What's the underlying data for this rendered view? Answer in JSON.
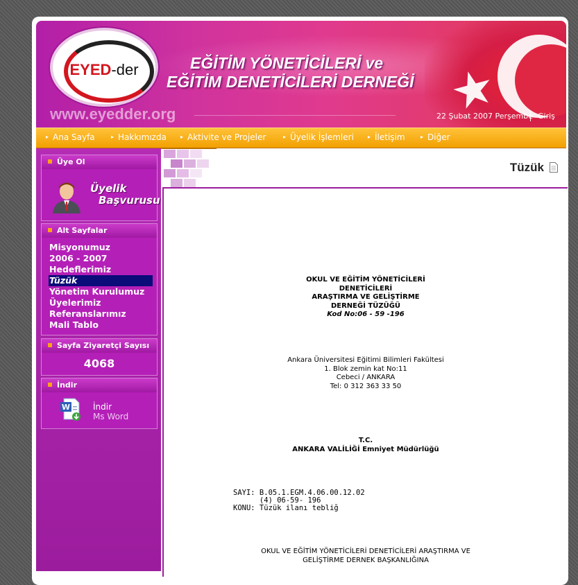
{
  "header": {
    "logo_text_brand": "EYED",
    "logo_text_suffix": "-der",
    "title_line1": "EĞİTİM YÖNETİCİLERİ ve",
    "title_line2": "EĞİTİM DENETİCİLERİ DERNEĞİ",
    "url": "www.eyedder.org",
    "date": "22 Şubat 2007 Perşembe",
    "login": "Giriş"
  },
  "nav": {
    "items": [
      "Ana Sayfa",
      "Hakkımızda",
      "Aktivite ve Projeler",
      "Üyelik İşlemleri",
      "İletişim",
      "Diğer"
    ]
  },
  "sidebar": {
    "uye_ol": {
      "title": "Üye Ol",
      "link_line1": "Üyelik",
      "link_line2": "Başvurusu"
    },
    "alt_sayfalar": {
      "title": "Alt Sayfalar",
      "items": [
        "Misyonumuz",
        "2006 - 2007",
        "Hedeflerimiz",
        "Tüzük",
        "Yönetim Kurulumuz",
        "Üyelerimiz",
        "Referanslarımız",
        "Mali Tablo"
      ],
      "active_index": 3
    },
    "visitor": {
      "title": "Sayfa Ziyaretçi Sayısı",
      "count": "4068"
    },
    "indir": {
      "title": "İndir",
      "link_label": "İndir",
      "link_sub": "Ms Word"
    }
  },
  "page": {
    "title": "Tüzük"
  },
  "document": {
    "heading1": "OKUL VE EĞİTİM YÖNETİCİLERİ",
    "heading2": "DENETİCİLERİ",
    "heading3": "ARAŞTIRMA VE GELİŞTİRME",
    "heading4": "DERNEĞİ TÜZÜĞÜ",
    "code": "Kod No:06 - 59 -196",
    "address1": "Ankara Üniversitesi Eğitimi Bilimleri Fakültesi",
    "address2": "1. Blok zemin kat No:11",
    "address3": "Cebeci / ANKARA",
    "address4": "Tel: 0 312 363 33 50",
    "tc": "T.C.",
    "valilik": "ANKARA VALİLİĞİ Emniyet Müdürlüğü",
    "sayi_line1": "SAYI: B.05.1.EGM.4.06.00.12.02",
    "sayi_line2": "      (4) 06-59- 196",
    "konu": "KONU: Tüzük ilanı tebliğ",
    "recipient1": "OKUL VE EĞİTİM YÖNETİCİLERİ DENETİCİLERİ ARAŞTIRMA VE",
    "recipient2": "GELİŞTİRME DERNEK BAŞKANLIĞINA"
  }
}
